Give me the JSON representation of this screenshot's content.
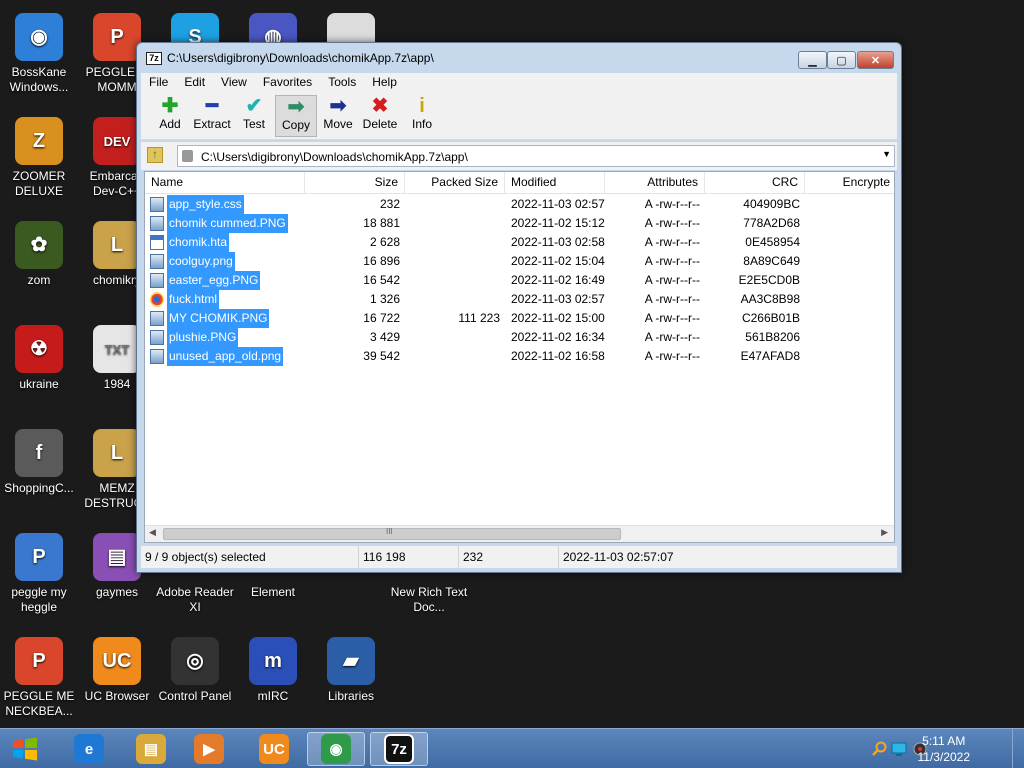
{
  "desktop": {
    "icons": [
      {
        "label": "BossKane Windows...",
        "glyph": "◉",
        "color": "#2d7fd8",
        "icon": "disc-icon"
      },
      {
        "label": "PEGGLE M MOMM",
        "glyph": "P",
        "color": "#d9462c",
        "icon": "peggle-icon"
      },
      {
        "label": "",
        "glyph": "S",
        "color": "#1ea1e3",
        "icon": "skype-icon"
      },
      {
        "label": "",
        "glyph": "◍",
        "color": "#4a56c2",
        "icon": "globe-icon"
      },
      {
        "label": "",
        "glyph": "",
        "color": "#dcdcdc",
        "icon": "file-icon"
      },
      {
        "label": "ZOOMER DELUXE",
        "glyph": "Z",
        "color": "#d9901e",
        "icon": "zoomer-icon"
      },
      {
        "label": "Embarcad Dev-C++",
        "glyph": "DEV",
        "color": "#c31f1f",
        "icon": "devcpp-icon"
      },
      {
        "label": "zom",
        "glyph": "✿",
        "color": "#3a5a1f",
        "icon": "flower-icon"
      },
      {
        "label": "chomikry",
        "glyph": "L",
        "color": "#c9a24a",
        "icon": "shortcut-icon"
      },
      {
        "label": "ukraine",
        "glyph": "☢",
        "color": "#c61b1b",
        "icon": "radiation-icon"
      },
      {
        "label": "1984",
        "glyph": "TXT",
        "color": "#e6e6e6",
        "icon": "text-file-icon"
      },
      {
        "label": "ShoppingC...",
        "glyph": "f",
        "color": "#5a5a5a",
        "icon": "flash-icon"
      },
      {
        "label": "MEMZ DESTRUCT",
        "glyph": "L",
        "color": "#c9a24a",
        "icon": "shortcut-icon"
      },
      {
        "label": "peggle my heggle",
        "glyph": "P",
        "color": "#3a78cf",
        "icon": "peggle-icon"
      },
      {
        "label": "gaymes",
        "glyph": "▤",
        "color": "#8a4fb5",
        "icon": "folder-icon"
      },
      {
        "label": "Adobe Reader XI",
        "glyph": "",
        "color": "transparent",
        "icon": "adobe-icon"
      },
      {
        "label": "Element",
        "glyph": "",
        "color": "transparent",
        "icon": "element-icon"
      },
      {
        "label": "New Rich Text Doc...",
        "glyph": "",
        "color": "transparent",
        "icon": "rtf-icon"
      },
      {
        "label": "PEGGLE ME NECKBEA...",
        "glyph": "P",
        "color": "#d9462c",
        "icon": "peggle-icon"
      },
      {
        "label": "UC Browser",
        "glyph": "UC",
        "color": "#f08a1c",
        "icon": "uc-browser-icon"
      },
      {
        "label": "Control Panel",
        "glyph": "◎",
        "color": "#333333",
        "icon": "control-panel-icon"
      },
      {
        "label": "mIRC",
        "glyph": "m",
        "color": "#2a4fb8",
        "icon": "mirc-icon"
      },
      {
        "label": "Libraries",
        "glyph": "▰",
        "color": "#2c5ea8",
        "icon": "libraries-icon"
      }
    ]
  },
  "window": {
    "app_icon_text": "7z",
    "title": "C:\\Users\\digibrony\\Downloads\\chomikApp.7z\\app\\",
    "minimize": "▁",
    "maximize": "▢",
    "close": "✕"
  },
  "menu": [
    "File",
    "Edit",
    "View",
    "Favorites",
    "Tools",
    "Help"
  ],
  "toolbar": [
    {
      "label": "Add",
      "glyph": "✚",
      "color": "#22a52a",
      "icon": "add-icon"
    },
    {
      "label": "Extract",
      "glyph": "━",
      "color": "#1e3fb0",
      "icon": "extract-icon"
    },
    {
      "label": "Test",
      "glyph": "✔",
      "color": "#1bb3b3",
      "icon": "test-icon"
    },
    {
      "label": "Copy",
      "glyph": "➡",
      "color": "#2e8d62",
      "icon": "copy-icon"
    },
    {
      "label": "Move",
      "glyph": "➡",
      "color": "#1d2f8f",
      "icon": "move-icon"
    },
    {
      "label": "Delete",
      "glyph": "✖",
      "color": "#d61c1c",
      "icon": "delete-icon"
    },
    {
      "label": "Info",
      "glyph": "i",
      "color": "#c9a800",
      "icon": "info-icon"
    }
  ],
  "address": {
    "path": "C:\\Users\\digibrony\\Downloads\\chomikApp.7z\\app\\",
    "dropdown": "▼"
  },
  "columns": [
    "Name",
    "Size",
    "Packed Size",
    "Modified",
    "Attributes",
    "CRC",
    "Encrypte"
  ],
  "files": [
    {
      "name": "app_style.css",
      "size": "232",
      "packed": "",
      "modified": "2022-11-03 02:57",
      "attributes": "A -rw-r--r--",
      "crc": "404909BC",
      "type": "file"
    },
    {
      "name": "chomik cummed.PNG",
      "size": "18 881",
      "packed": "",
      "modified": "2022-11-02 15:12",
      "attributes": "A -rw-r--r--",
      "crc": "778A2D68",
      "type": "file"
    },
    {
      "name": "chomik.hta",
      "size": "2 628",
      "packed": "",
      "modified": "2022-11-03 02:58",
      "attributes": "A -rw-r--r--",
      "crc": "0E458954",
      "type": "hta"
    },
    {
      "name": "coolguy.png",
      "size": "16 896",
      "packed": "",
      "modified": "2022-11-02 15:04",
      "attributes": "A -rw-r--r--",
      "crc": "8A89C649",
      "type": "file"
    },
    {
      "name": "easter_egg.PNG",
      "size": "16 542",
      "packed": "",
      "modified": "2022-11-02 16:49",
      "attributes": "A -rw-r--r--",
      "crc": "E2E5CD0B",
      "type": "file"
    },
    {
      "name": "fuck.html",
      "size": "1 326",
      "packed": "",
      "modified": "2022-11-03 02:57",
      "attributes": "A -rw-r--r--",
      "crc": "AA3C8B98",
      "type": "browser"
    },
    {
      "name": "MY CHOMIK.PNG",
      "size": "16 722",
      "packed": "111 223",
      "modified": "2022-11-02 15:00",
      "attributes": "A -rw-r--r--",
      "crc": "C266B01B",
      "type": "file"
    },
    {
      "name": "plushie.PNG",
      "size": "3 429",
      "packed": "",
      "modified": "2022-11-02 16:34",
      "attributes": "A -rw-r--r--",
      "crc": "561B8206",
      "type": "file"
    },
    {
      "name": "unused_app_old.png",
      "size": "39 542",
      "packed": "",
      "modified": "2022-11-02 16:58",
      "attributes": "A -rw-r--r--",
      "crc": "E47AFAD8",
      "type": "file"
    }
  ],
  "scroll": {
    "left": "◀",
    "right": "▶",
    "grip": "III"
  },
  "status": {
    "selected": "9 / 9 object(s) selected",
    "total_size": "116 198",
    "packed": "232",
    "modified": "2022-11-03 02:57:07"
  },
  "taskbar": {
    "apps": [
      {
        "glyph": "e",
        "color": "#1e78d4",
        "icon": "internet-explorer-icon"
      },
      {
        "glyph": "▤",
        "color": "#d9a93b",
        "icon": "file-explorer-icon"
      },
      {
        "glyph": "▶",
        "color": "#e37b2a",
        "icon": "media-player-icon"
      },
      {
        "glyph": "UC",
        "color": "#f08a1c",
        "icon": "uc-browser-icon"
      },
      {
        "glyph": "◉",
        "color": "#2e9a4a",
        "icon": "chrome-icon"
      },
      {
        "glyph": "7z",
        "color": "#111111",
        "icon": "7zip-icon"
      }
    ],
    "time": "5:11 AM",
    "date": "11/3/2022"
  }
}
